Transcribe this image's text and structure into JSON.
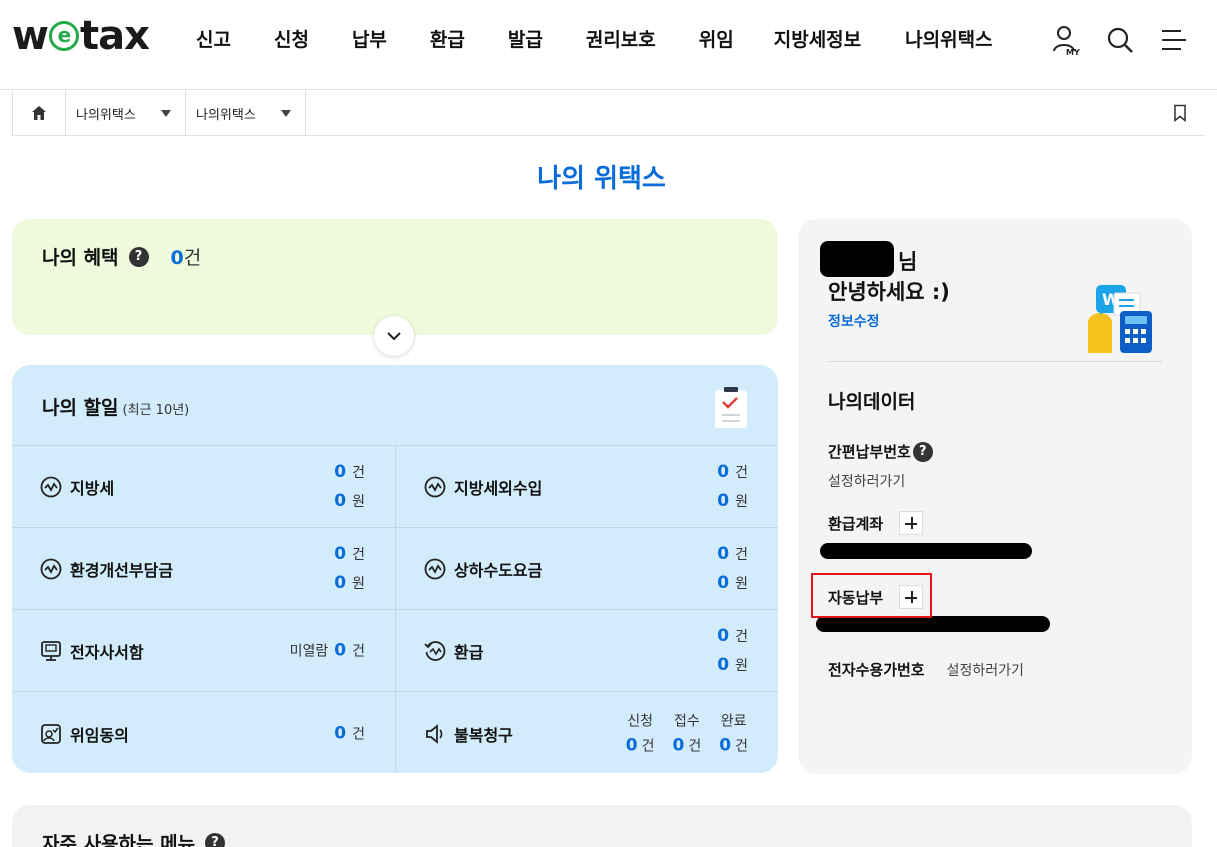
{
  "header": {
    "logo": {
      "prefix": "w",
      "e": "e",
      "suffix": "tax"
    },
    "nav": [
      "신고",
      "신청",
      "납부",
      "환급",
      "발급",
      "권리보호",
      "위임",
      "지방세정보",
      "나의위택스"
    ],
    "icons": [
      "my-icon",
      "search-icon",
      "menu-icon"
    ],
    "my_label": "MY"
  },
  "breadcrumb": {
    "items": [
      "나의위택스",
      "나의위택스"
    ]
  },
  "page_title": "나의 위택스",
  "benefit": {
    "title": "나의 혜택",
    "count": "0",
    "unit": "건"
  },
  "todo": {
    "title": "나의 할일",
    "subtitle": "(최근 10년)",
    "rows": [
      [
        {
          "label": "지방세",
          "lines": [
            {
              "num": "0",
              "unit": "건"
            },
            {
              "num": "0",
              "unit": "원"
            }
          ]
        },
        {
          "label": "지방세외수입",
          "lines": [
            {
              "num": "0",
              "unit": "건"
            },
            {
              "num": "0",
              "unit": "원"
            }
          ]
        }
      ],
      [
        {
          "label": "환경개선부담금",
          "lines": [
            {
              "num": "0",
              "unit": "건"
            },
            {
              "num": "0",
              "unit": "원"
            }
          ]
        },
        {
          "label": "상하수도요금",
          "lines": [
            {
              "num": "0",
              "unit": "건"
            },
            {
              "num": "0",
              "unit": "원"
            }
          ]
        }
      ],
      [
        {
          "label": "전자사서함",
          "prefix": "미열람",
          "num": "0",
          "unit": "건"
        },
        {
          "label": "환급",
          "lines": [
            {
              "num": "0",
              "unit": "건"
            },
            {
              "num": "0",
              "unit": "원"
            }
          ]
        }
      ],
      [
        {
          "label": "위임동의",
          "num": "0",
          "unit": "건"
        },
        {
          "label": "불복청구",
          "columns": [
            {
              "head": "신청",
              "num": "0",
              "unit": "건"
            },
            {
              "head": "접수",
              "num": "0",
              "unit": "건"
            },
            {
              "head": "완료",
              "num": "0",
              "unit": "건"
            }
          ]
        }
      ]
    ]
  },
  "side": {
    "name_suffix": "님",
    "greeting": "안녕하세요 :)",
    "edit_link": "정보수정",
    "my_data_title": "나의데이터",
    "easy_pay_label": "간편납부번호",
    "easy_pay_sub": "설정하러가기",
    "refund_account_label": "환급계좌",
    "auto_pay_label": "자동납부",
    "e_consent_label": "전자수용가번호",
    "e_consent_sub": "설정하러가기"
  },
  "frequent_menu": {
    "title": "자주 사용하는 메뉴"
  },
  "colors": {
    "accent": "#0a6cd8",
    "benefit_bg": "#eefadb",
    "todo_bg": "#d3ecfb",
    "side_bg": "#f4f4f5",
    "highlight": "#e01818"
  }
}
